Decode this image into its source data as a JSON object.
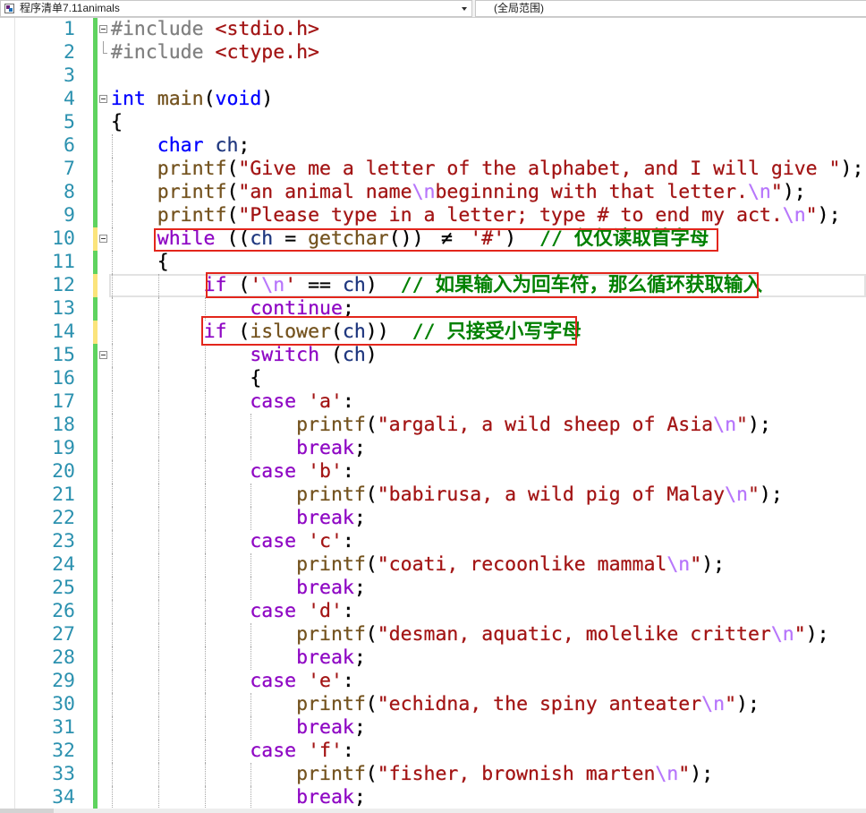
{
  "navbar": {
    "project": "程序清单7.11animals",
    "project_icon": "project-file-icon",
    "dropdown_icon": "chevron-down-icon",
    "scope": "(全局范围)"
  },
  "colors": {
    "line_number": "#2b91af",
    "change_saved": "#5fd35f",
    "change_unsaved": "#fbe47b",
    "annotation": "#e3261c",
    "current_line_border": "#e2e2e2",
    "indent_guide": "#a8a8a8"
  },
  "syntax_colors": {
    "pp": "#808080",
    "str": "#a31515",
    "esc": "#b776fb",
    "kw": "#0000ff",
    "ctl": "#8f08c4",
    "fn": "#74531f",
    "var": "#1f377f",
    "p": "#000000",
    "op": "#000000",
    "op2": "#000000",
    "cmt": "#008000"
  },
  "editor": {
    "current_line": 12,
    "lines": [
      {
        "n": "1",
        "fold": true,
        "tokens": [
          [
            "#include ",
            "pp"
          ],
          [
            "<stdio.h>",
            "str"
          ]
        ]
      },
      {
        "n": "2",
        "fold_end": true,
        "tokens": [
          [
            "#include ",
            "pp"
          ],
          [
            "<ctype.h>",
            "str"
          ]
        ]
      },
      {
        "n": "3",
        "tokens": []
      },
      {
        "n": "4",
        "fold": true,
        "tokens": [
          [
            "int",
            "kw"
          ],
          [
            " ",
            "p"
          ],
          [
            "main",
            "fn"
          ],
          [
            "(",
            "p"
          ],
          [
            "void",
            "kw"
          ],
          [
            ")",
            "p"
          ]
        ]
      },
      {
        "n": "5",
        "tokens": [
          [
            "{",
            "p"
          ]
        ]
      },
      {
        "n": "6",
        "tokens": [
          [
            "    ",
            "p"
          ],
          [
            "char",
            "kw"
          ],
          [
            " ",
            "p"
          ],
          [
            "ch",
            "var"
          ],
          [
            ";",
            "p"
          ]
        ]
      },
      {
        "n": "7",
        "tokens": [
          [
            "    ",
            "p"
          ],
          [
            "printf",
            "fn"
          ],
          [
            "(",
            "p"
          ],
          [
            "\"Give me a letter of the alphabet, and I will give \"",
            "str"
          ],
          [
            ");",
            "p"
          ]
        ]
      },
      {
        "n": "8",
        "tokens": [
          [
            "    ",
            "p"
          ],
          [
            "printf",
            "fn"
          ],
          [
            "(",
            "p"
          ],
          [
            "\"an animal name",
            "str"
          ],
          [
            "\\n",
            "esc"
          ],
          [
            "beginning with that letter.",
            "str"
          ],
          [
            "\\n",
            "esc"
          ],
          [
            "\"",
            "str"
          ],
          [
            ");",
            "p"
          ]
        ]
      },
      {
        "n": "9",
        "tokens": [
          [
            "    ",
            "p"
          ],
          [
            "printf",
            "fn"
          ],
          [
            "(",
            "p"
          ],
          [
            "\"Please type in a letter; type # to end my act.",
            "str"
          ],
          [
            "\\n",
            "esc"
          ],
          [
            "\"",
            "str"
          ],
          [
            ");",
            "p"
          ]
        ]
      },
      {
        "n": "10",
        "fold": true,
        "change": "unsaved",
        "tokens": [
          [
            "    ",
            "p"
          ],
          [
            "while",
            "ctl"
          ],
          [
            " ((",
            "p"
          ],
          [
            "ch",
            "var"
          ],
          [
            " = ",
            "p"
          ],
          [
            "getchar",
            "fn"
          ],
          [
            "()) ",
            "p"
          ],
          [
            "≠",
            "op2"
          ],
          [
            " ",
            "p"
          ],
          [
            "'#'",
            "str"
          ],
          [
            ")  ",
            "p"
          ],
          [
            "// 仅仅读取首字母",
            "cmt"
          ]
        ]
      },
      {
        "n": "11",
        "tokens": [
          [
            "    ",
            "p"
          ],
          [
            "{",
            "p"
          ]
        ]
      },
      {
        "n": "12",
        "change": "unsaved",
        "tokens": [
          [
            "        ",
            "p"
          ],
          [
            "if",
            "ctl"
          ],
          [
            " (",
            "p"
          ],
          [
            "'",
            "str"
          ],
          [
            "\\n",
            "esc"
          ],
          [
            "'",
            "str"
          ],
          [
            " ",
            "p"
          ],
          [
            "==",
            "op"
          ],
          [
            " ",
            "p"
          ],
          [
            "ch",
            "var"
          ],
          [
            ")  ",
            "p"
          ],
          [
            "// 如果输入为回车符，那么循环获取输入",
            "cmt"
          ]
        ]
      },
      {
        "n": "13",
        "tokens": [
          [
            "            ",
            "p"
          ],
          [
            "continue",
            "ctl"
          ],
          [
            ";",
            "p"
          ]
        ]
      },
      {
        "n": "14",
        "change": "unsaved",
        "tokens": [
          [
            "        ",
            "p"
          ],
          [
            "if",
            "ctl"
          ],
          [
            " (",
            "p"
          ],
          [
            "islower",
            "fn"
          ],
          [
            "(",
            "p"
          ],
          [
            "ch",
            "var"
          ],
          [
            "))  ",
            "p"
          ],
          [
            "// 只接受小写字母",
            "cmt"
          ]
        ]
      },
      {
        "n": "15",
        "fold": true,
        "tokens": [
          [
            "            ",
            "p"
          ],
          [
            "switch",
            "ctl"
          ],
          [
            " (",
            "p"
          ],
          [
            "ch",
            "var"
          ],
          [
            ")",
            "p"
          ]
        ]
      },
      {
        "n": "16",
        "tokens": [
          [
            "            ",
            "p"
          ],
          [
            "{",
            "p"
          ]
        ]
      },
      {
        "n": "17",
        "tokens": [
          [
            "            ",
            "p"
          ],
          [
            "case",
            "ctl"
          ],
          [
            " ",
            "p"
          ],
          [
            "'a'",
            "str"
          ],
          [
            ":",
            "p"
          ]
        ]
      },
      {
        "n": "18",
        "tokens": [
          [
            "                ",
            "p"
          ],
          [
            "printf",
            "fn"
          ],
          [
            "(",
            "p"
          ],
          [
            "\"argali, a wild sheep of Asia",
            "str"
          ],
          [
            "\\n",
            "esc"
          ],
          [
            "\"",
            "str"
          ],
          [
            ");",
            "p"
          ]
        ]
      },
      {
        "n": "19",
        "tokens": [
          [
            "                ",
            "p"
          ],
          [
            "break",
            "ctl"
          ],
          [
            ";",
            "p"
          ]
        ]
      },
      {
        "n": "20",
        "tokens": [
          [
            "            ",
            "p"
          ],
          [
            "case",
            "ctl"
          ],
          [
            " ",
            "p"
          ],
          [
            "'b'",
            "str"
          ],
          [
            ":",
            "p"
          ]
        ]
      },
      {
        "n": "21",
        "tokens": [
          [
            "                ",
            "p"
          ],
          [
            "printf",
            "fn"
          ],
          [
            "(",
            "p"
          ],
          [
            "\"babirusa, a wild pig of Malay",
            "str"
          ],
          [
            "\\n",
            "esc"
          ],
          [
            "\"",
            "str"
          ],
          [
            ");",
            "p"
          ]
        ]
      },
      {
        "n": "22",
        "tokens": [
          [
            "                ",
            "p"
          ],
          [
            "break",
            "ctl"
          ],
          [
            ";",
            "p"
          ]
        ]
      },
      {
        "n": "23",
        "tokens": [
          [
            "            ",
            "p"
          ],
          [
            "case",
            "ctl"
          ],
          [
            " ",
            "p"
          ],
          [
            "'c'",
            "str"
          ],
          [
            ":",
            "p"
          ]
        ]
      },
      {
        "n": "24",
        "tokens": [
          [
            "                ",
            "p"
          ],
          [
            "printf",
            "fn"
          ],
          [
            "(",
            "p"
          ],
          [
            "\"coati, recoonlike mammal",
            "str"
          ],
          [
            "\\n",
            "esc"
          ],
          [
            "\"",
            "str"
          ],
          [
            ");",
            "p"
          ]
        ]
      },
      {
        "n": "25",
        "tokens": [
          [
            "                ",
            "p"
          ],
          [
            "break",
            "ctl"
          ],
          [
            ";",
            "p"
          ]
        ]
      },
      {
        "n": "26",
        "tokens": [
          [
            "            ",
            "p"
          ],
          [
            "case",
            "ctl"
          ],
          [
            " ",
            "p"
          ],
          [
            "'d'",
            "str"
          ],
          [
            ":",
            "p"
          ]
        ]
      },
      {
        "n": "27",
        "tokens": [
          [
            "                ",
            "p"
          ],
          [
            "printf",
            "fn"
          ],
          [
            "(",
            "p"
          ],
          [
            "\"desman, aquatic, molelike critter",
            "str"
          ],
          [
            "\\n",
            "esc"
          ],
          [
            "\"",
            "str"
          ],
          [
            ");",
            "p"
          ]
        ]
      },
      {
        "n": "28",
        "tokens": [
          [
            "                ",
            "p"
          ],
          [
            "break",
            "ctl"
          ],
          [
            ";",
            "p"
          ]
        ]
      },
      {
        "n": "29",
        "tokens": [
          [
            "            ",
            "p"
          ],
          [
            "case",
            "ctl"
          ],
          [
            " ",
            "p"
          ],
          [
            "'e'",
            "str"
          ],
          [
            ":",
            "p"
          ]
        ]
      },
      {
        "n": "30",
        "tokens": [
          [
            "                ",
            "p"
          ],
          [
            "printf",
            "fn"
          ],
          [
            "(",
            "p"
          ],
          [
            "\"echidna, the spiny anteater",
            "str"
          ],
          [
            "\\n",
            "esc"
          ],
          [
            "\"",
            "str"
          ],
          [
            ");",
            "p"
          ]
        ]
      },
      {
        "n": "31",
        "tokens": [
          [
            "                ",
            "p"
          ],
          [
            "break",
            "ctl"
          ],
          [
            ";",
            "p"
          ]
        ]
      },
      {
        "n": "32",
        "tokens": [
          [
            "            ",
            "p"
          ],
          [
            "case",
            "ctl"
          ],
          [
            " ",
            "p"
          ],
          [
            "'f'",
            "str"
          ],
          [
            ":",
            "p"
          ]
        ]
      },
      {
        "n": "33",
        "tokens": [
          [
            "                ",
            "p"
          ],
          [
            "printf",
            "fn"
          ],
          [
            "(",
            "p"
          ],
          [
            "\"fisher, brownish marten",
            "str"
          ],
          [
            "\\n",
            "esc"
          ],
          [
            "\"",
            "str"
          ],
          [
            ");",
            "p"
          ]
        ]
      },
      {
        "n": "34",
        "tokens": [
          [
            "                ",
            "p"
          ],
          [
            "break",
            "ctl"
          ],
          [
            ";",
            "p"
          ]
        ]
      }
    ]
  }
}
